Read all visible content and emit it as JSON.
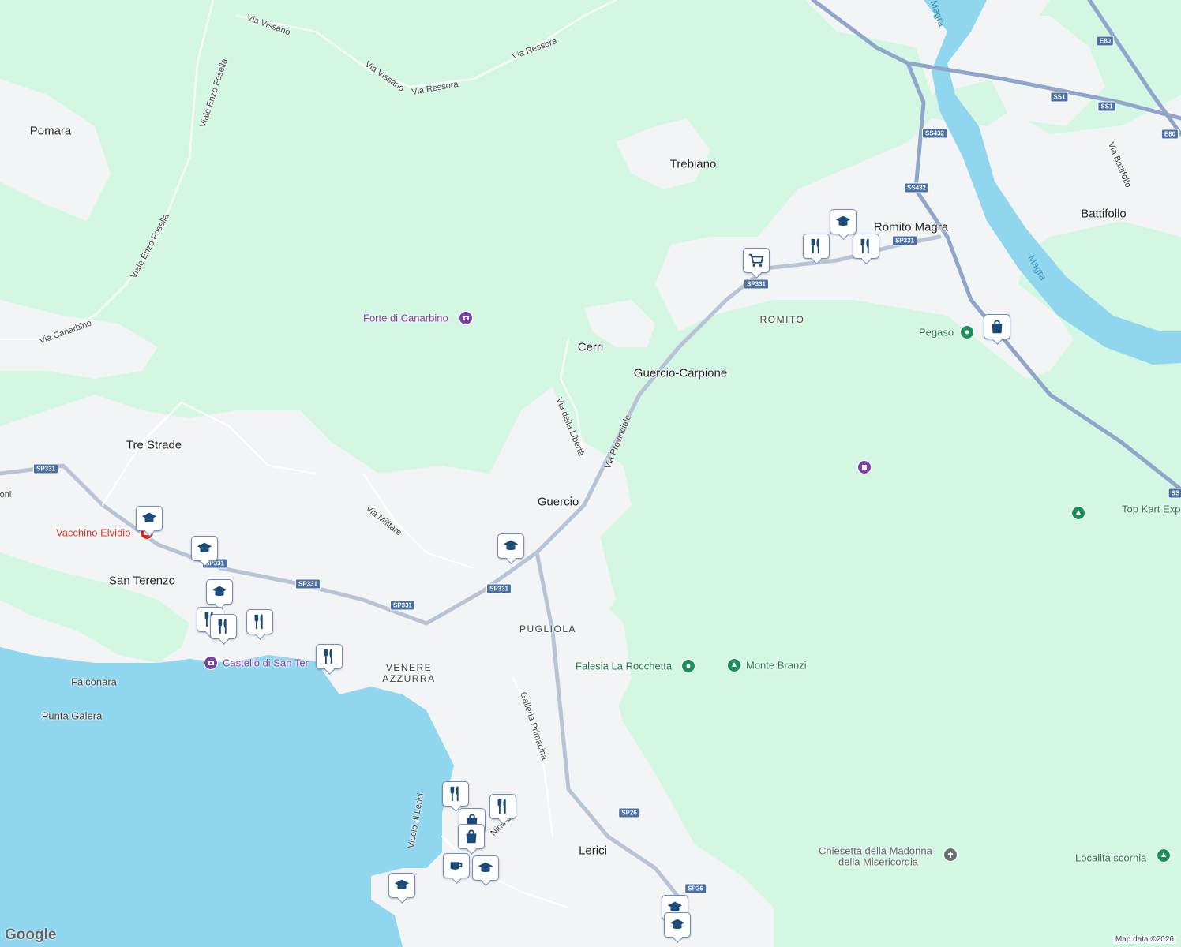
{
  "map": {
    "colors": {
      "land": "#f3f4f5",
      "forest": "#d3f7e3",
      "water": "#8fd6ee",
      "motorway": "#8fa5c9",
      "road": "#ffffff",
      "pin_border": "#6e8cc4",
      "pin_icon": "#1a4a78"
    },
    "places": [
      {
        "name": "Pomara"
      },
      {
        "name": "Trebiano"
      },
      {
        "name": "Battifollo"
      },
      {
        "name": "Romito Magra"
      },
      {
        "name": "Cerri"
      },
      {
        "name": "Guercio-Carpione"
      },
      {
        "name": "Tre Strade"
      },
      {
        "name": "Guercio"
      },
      {
        "name": "San Terenzo"
      },
      {
        "name": "Falconara"
      },
      {
        "name": "Punta Galera"
      },
      {
        "name": "Lerici"
      }
    ],
    "districts": [
      {
        "name": "ROMITO"
      },
      {
        "name": "PUGLIOLA"
      },
      {
        "name": "VENERE AZZURRA"
      }
    ],
    "roads": [
      {
        "name": "Via Vissano"
      },
      {
        "name": "Via Vissano"
      },
      {
        "name": "Via Ressora"
      },
      {
        "name": "Via Ressora"
      },
      {
        "name": "Viale Enzo Fosella"
      },
      {
        "name": "Viale Enzo Fosella"
      },
      {
        "name": "Via Canarbino"
      },
      {
        "name": "Via della Libertà"
      },
      {
        "name": "Via Provinciale"
      },
      {
        "name": "Via Militare"
      },
      {
        "name": "Galleria Primacina"
      },
      {
        "name": "Via Battifollo"
      },
      {
        "name": "Magra"
      },
      {
        "name": "Magra"
      },
      {
        "name": "oni"
      },
      {
        "name": "Vicolo di Lerici"
      },
      {
        "name": "Nino Bi"
      }
    ],
    "shields": [
      {
        "text": "SP331"
      },
      {
        "text": "SP331"
      },
      {
        "text": "SP331"
      },
      {
        "text": "SP331"
      },
      {
        "text": "SP331"
      },
      {
        "text": "SP331"
      },
      {
        "text": "SP331"
      },
      {
        "text": "SS432"
      },
      {
        "text": "SS432"
      },
      {
        "text": "SS1"
      },
      {
        "text": "SS1"
      },
      {
        "text": "E80"
      },
      {
        "text": "E80"
      },
      {
        "text": "SP26"
      },
      {
        "text": "SP26"
      },
      {
        "text": "SS"
      }
    ],
    "pois": [
      {
        "name": "Forte di Canarbino",
        "kind": "camera-icon"
      },
      {
        "name": "Castello di San Ter",
        "kind": "camera-icon"
      },
      {
        "name": "Vacchino Elvidio",
        "kind": "shop-icon"
      },
      {
        "name": "Pegaso",
        "kind": "pin-icon"
      },
      {
        "name": "Falesia La Rocchetta",
        "kind": "pin-icon"
      },
      {
        "name": "Monte Branzi",
        "kind": "tree-icon"
      },
      {
        "name": "Top Kart Exp",
        "kind": "tree-icon"
      },
      {
        "name": "Chiesetta della Madonna",
        "kind": "church-icon"
      },
      {
        "name": "della Misericordia",
        "kind": "church-icon"
      },
      {
        "name": "Localita scornia",
        "kind": "tree-icon"
      }
    ],
    "markers": [
      {
        "icon": "graduation-cap-icon"
      },
      {
        "icon": "fork-knife-icon"
      },
      {
        "icon": "fork-knife-icon"
      },
      {
        "icon": "cart-icon"
      },
      {
        "icon": "shopping-bag-icon"
      },
      {
        "icon": "graduation-cap-icon"
      },
      {
        "icon": "graduation-cap-icon"
      },
      {
        "icon": "graduation-cap-icon"
      },
      {
        "icon": "graduation-cap-icon"
      },
      {
        "icon": "fork-knife-icon"
      },
      {
        "icon": "fork-knife-icon"
      },
      {
        "icon": "fork-knife-icon"
      },
      {
        "icon": "fork-knife-icon"
      },
      {
        "icon": "fork-knife-icon"
      },
      {
        "icon": "fork-knife-icon"
      },
      {
        "icon": "shopping-bag-icon"
      },
      {
        "icon": "shopping-bag-icon"
      },
      {
        "icon": "coffee-icon"
      },
      {
        "icon": "graduation-cap-icon"
      },
      {
        "icon": "graduation-cap-icon"
      },
      {
        "icon": "graduation-cap-icon"
      },
      {
        "icon": "graduation-cap-icon"
      }
    ],
    "logo": "Google",
    "attribution": "Map data ©2026"
  }
}
